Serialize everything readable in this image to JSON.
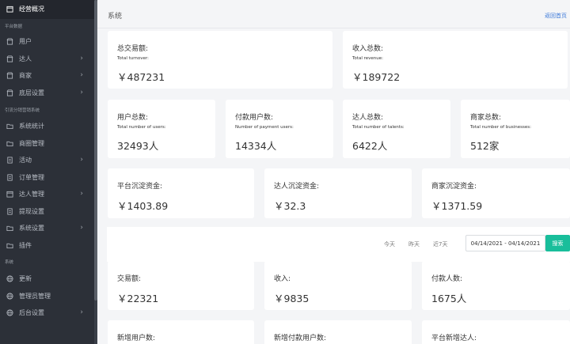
{
  "sidebar": {
    "top_item": "经营概况",
    "section_platform": "平台数据",
    "section_distribution": "引流分销营销系统",
    "section_system": "系统",
    "items_platform": [
      {
        "label": "用户",
        "icon": "store-icon",
        "chevron": false
      },
      {
        "label": "达人",
        "icon": "store-icon",
        "chevron": true
      },
      {
        "label": "商家",
        "icon": "store-icon",
        "chevron": true
      },
      {
        "label": "底层设置",
        "icon": "store-icon",
        "chevron": true
      }
    ],
    "items_distribution": [
      {
        "label": "系统统计",
        "icon": "folder-icon",
        "chevron": false
      },
      {
        "label": "商圈管理",
        "icon": "folder-icon",
        "chevron": false
      },
      {
        "label": "活动",
        "icon": "document-icon",
        "chevron": true
      },
      {
        "label": "订单管理",
        "icon": "document-icon",
        "chevron": false
      },
      {
        "label": "达人管理",
        "icon": "calendar-icon",
        "chevron": true
      },
      {
        "label": "提现设置",
        "icon": "document-icon",
        "chevron": false
      },
      {
        "label": "系统设置",
        "icon": "folder-icon",
        "chevron": true
      },
      {
        "label": "插件",
        "icon": "folder-icon",
        "chevron": false
      }
    ],
    "items_system": [
      {
        "label": "更新",
        "icon": "globe-icon",
        "chevron": false
      },
      {
        "label": "管理员管理",
        "icon": "globe-icon",
        "chevron": false
      },
      {
        "label": "后台设置",
        "icon": "globe-icon",
        "chevron": true
      }
    ],
    "chevron_glyph": "›"
  },
  "header": {
    "title": "系统",
    "back_link": "返回首页"
  },
  "summary": {
    "total_turnover": {
      "label": "总交易额:",
      "sub": "Total turnover:",
      "value": "￥487231"
    },
    "total_revenue": {
      "label": "收入总数:",
      "sub": "Total revenue:",
      "value": "￥189722"
    }
  },
  "users_row": [
    {
      "label": "用户总数:",
      "sub": "Total number of users:",
      "value": "32493人"
    },
    {
      "label": "付款用户数:",
      "sub": "Number of payment users:",
      "value": "14334人"
    },
    {
      "label": "达人总数:",
      "sub": "Total number of talents:",
      "value": "6422人"
    },
    {
      "label": "商家总数:",
      "sub": "Total number of businesses:",
      "value": "512家"
    }
  ],
  "funds_row": [
    {
      "label": "平台沉淀资金:",
      "value": "￥1403.89"
    },
    {
      "label": "达人沉淀资金:",
      "value": "￥32.3"
    },
    {
      "label": "商家沉淀资金:",
      "value": "￥1371.59"
    }
  ],
  "filter": {
    "today": "今天",
    "yesterday": "昨天",
    "last7": "近7天",
    "date_range": "04/14/2021 - 04/14/2021",
    "search": "搜索"
  },
  "period_row": [
    {
      "label": "交易额:",
      "value": "￥22321"
    },
    {
      "label": "收入:",
      "value": "￥9835"
    },
    {
      "label": "付款人数:",
      "value": "1675人"
    }
  ],
  "new_row": [
    {
      "label": "新增用户数:"
    },
    {
      "label": "新增付款用户数:"
    },
    {
      "label": "平台新增达人:"
    }
  ],
  "colors": {
    "sidebar_bg": "#2c3038",
    "accent_green": "#19be9b",
    "link_blue": "#3a78d8"
  }
}
